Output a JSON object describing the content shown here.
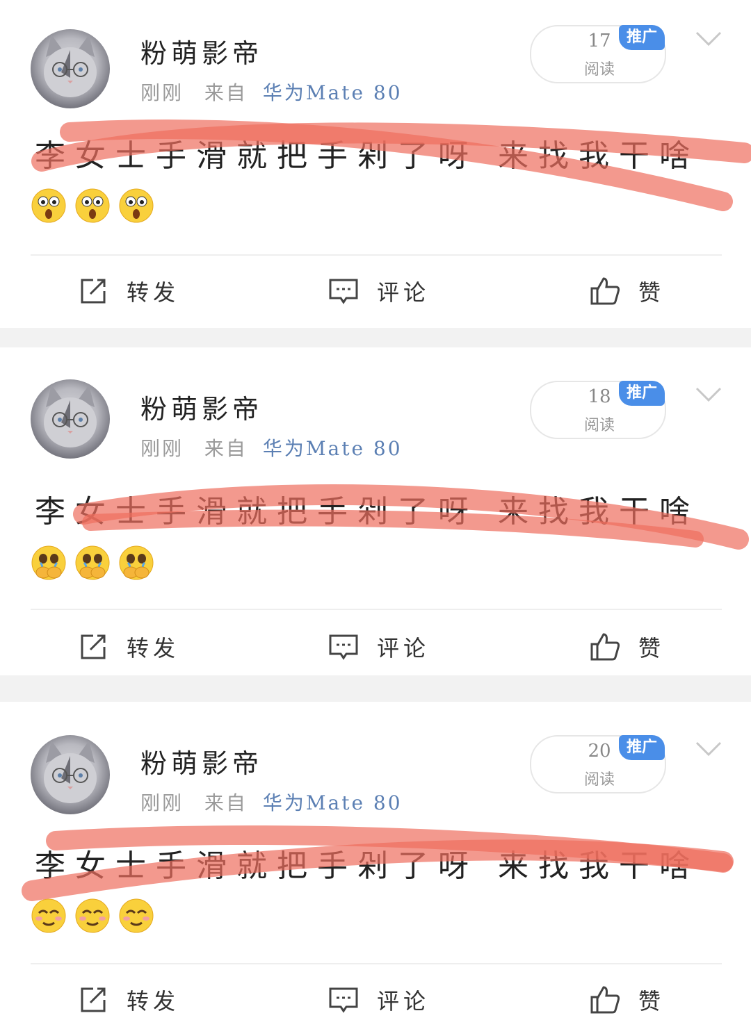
{
  "posts": [
    {
      "author": "粉萌影帝",
      "time": "刚刚",
      "from": "来自",
      "source": "华为Mate 80",
      "reads_count": "17",
      "reads_label": "阅读",
      "promo_badge": "推广",
      "text": "李女士手滑就把手剁了呀 来找我干啥",
      "emoji_icon": "shocked-face-emoji",
      "actions": {
        "repost": "转发",
        "comment": "评论",
        "like": "赞"
      }
    },
    {
      "author": "粉萌影帝",
      "time": "刚刚",
      "from": "来自",
      "source": "华为Mate 80",
      "reads_count": "18",
      "reads_label": "阅读",
      "promo_badge": "推广",
      "text": "李女士手滑就把手剁了呀 来找我干啥",
      "emoji_icon": "crying-covering-mouth-emoji",
      "actions": {
        "repost": "转发",
        "comment": "评论",
        "like": "赞"
      }
    },
    {
      "author": "粉萌影帝",
      "time": "刚刚",
      "from": "来自",
      "source": "华为Mate 80",
      "reads_count": "20",
      "reads_label": "阅读",
      "promo_badge": "推广",
      "text": "李女士手滑就把手剁了呀 来找我干啥",
      "emoji_icon": "smirk-face-emoji",
      "actions": {
        "repost": "转发",
        "comment": "评论",
        "like": "赞"
      }
    }
  ],
  "colors": {
    "background": "#f2f2f2",
    "card": "#ffffff",
    "promo_blue": "#4a8ee8",
    "source_link": "#5b7fb3",
    "strike_red": "#ee6e5e"
  }
}
